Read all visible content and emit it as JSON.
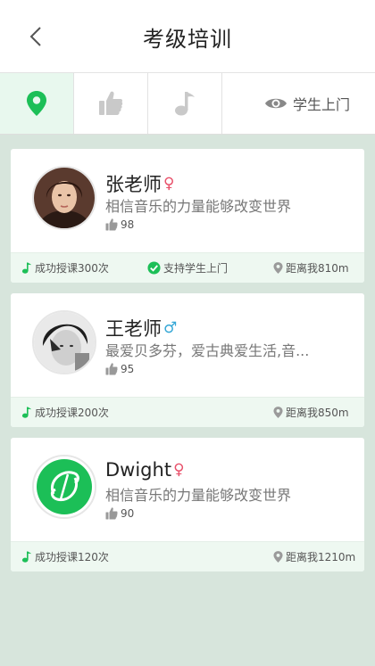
{
  "header": {
    "title": "考级培训"
  },
  "filters": {
    "visit_label": "学生上门"
  },
  "colors": {
    "accent": "#1cbf57",
    "female": "#e8506a",
    "male": "#35a7d6",
    "background": "#d7e5dc"
  },
  "teachers": [
    {
      "name": "张老师",
      "gender": "♀",
      "description": "相信音乐的力量能够改变世界",
      "likes": "98",
      "lessons": "成功授课300次",
      "supports_visit": "支持学生上门",
      "distance": "距离我810m"
    },
    {
      "name": "王老师",
      "gender": "♂",
      "description": "最爱贝多芬，爱古典爱生活,音...",
      "likes": "95",
      "lessons": "成功授课200次",
      "distance": "距离我850m"
    },
    {
      "name": "Dwight",
      "gender": "♀",
      "description": "相信音乐的力量能够改变世界",
      "likes": "90",
      "lessons": "成功授课120次",
      "distance": "距离我1210m"
    }
  ]
}
